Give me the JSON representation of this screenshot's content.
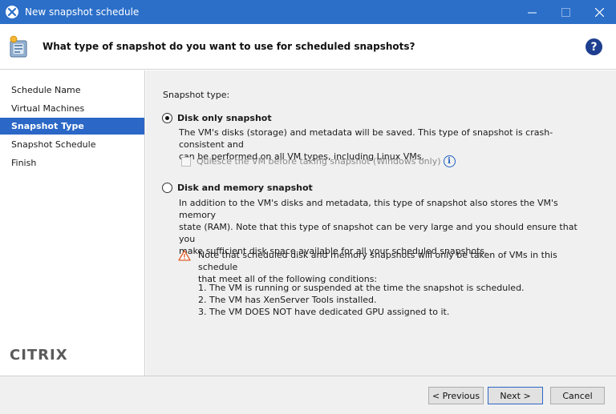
{
  "window": {
    "title": "New snapshot schedule"
  },
  "header": {
    "heading": "What type of snapshot do you want to use for scheduled snapshots?",
    "help_glyph": "?"
  },
  "sidebar": {
    "items": [
      {
        "label": "Schedule Name"
      },
      {
        "label": "Virtual Machines"
      },
      {
        "label": "Snapshot Type"
      },
      {
        "label": "Snapshot Schedule"
      },
      {
        "label": "Finish"
      }
    ],
    "active_index": 2,
    "brand": "CITRIX"
  },
  "content": {
    "section_label": "Snapshot type:",
    "disk_only": {
      "label": "Disk only snapshot",
      "selected": true,
      "desc_line1": "The VM's disks (storage) and metadata will be saved. This type of snapshot is crash-consistent and",
      "desc_line2": "can be performed on all VM types, including Linux VMs.",
      "quiesce_label": "Quiesce the VM before taking snapshot (Windows only)",
      "quiesce_checked": false,
      "quiesce_enabled": false
    },
    "disk_memory": {
      "label": "Disk and memory snapshot",
      "selected": false,
      "desc_line1": "In addition to the VM's disks and metadata, this type of snapshot also stores the VM's memory",
      "desc_line2": "state (RAM). Note that this type of snapshot can be very large and you should ensure that you",
      "desc_line3": "make sufficient disk space available for all your scheduled snapshots."
    },
    "note": {
      "line1": "Note that scheduled disk and memory snapshots will only be taken of VMs in this schedule",
      "line2": "that meet all of the following conditions:",
      "conditions": [
        "1. The VM is running or suspended at the time the snapshot is scheduled.",
        "2. The VM has XenServer Tools installed.",
        "3. The VM DOES NOT have dedicated GPU assigned to it."
      ]
    }
  },
  "footer": {
    "previous_label": "< Previous",
    "next_label": "Next >",
    "cancel_label": "Cancel"
  }
}
